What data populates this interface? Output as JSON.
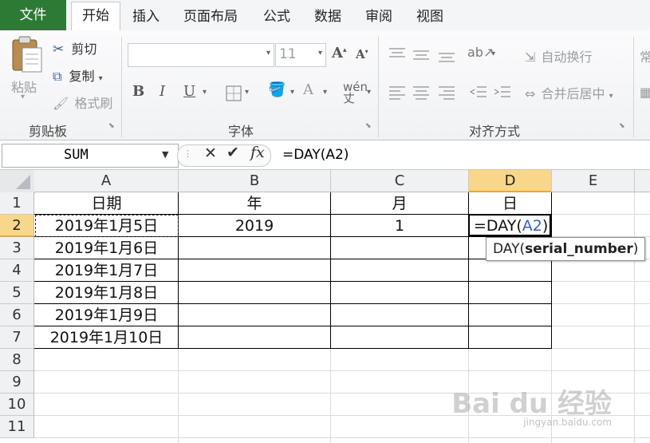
{
  "tabs": {
    "file": "文件",
    "items": [
      "开始",
      "插入",
      "页面布局",
      "公式",
      "数据",
      "审阅",
      "视图"
    ]
  },
  "clipboard": {
    "paste": "粘贴",
    "cut": "剪切",
    "copy": "复制",
    "format_painter": "格式刷",
    "group_label": "剪贴板"
  },
  "font": {
    "size": "11",
    "group_label": "字体"
  },
  "alignment": {
    "wrap_text": "自动换行",
    "merge_center": "合并后居中",
    "group_label": "对齐方式"
  },
  "number": {
    "format_partial": "常"
  },
  "formula_bar": {
    "name_box": "SUM",
    "formula": "=DAY(A2)"
  },
  "grid": {
    "columns": [
      "A",
      "B",
      "C",
      "D",
      "E"
    ],
    "rows": [
      "1",
      "2",
      "3",
      "4",
      "5",
      "6",
      "7",
      "8",
      "9",
      "10",
      "11"
    ],
    "header_row": {
      "A": "日期",
      "B": "年",
      "C": "月",
      "D": "日"
    },
    "data": [
      {
        "A": "2019年1月5日",
        "B": "2019",
        "C": "1"
      },
      {
        "A": "2019年1月6日"
      },
      {
        "A": "2019年1月7日"
      },
      {
        "A": "2019年1月8日"
      },
      {
        "A": "2019年1月9日"
      },
      {
        "A": "2019年1月10日"
      }
    ],
    "editing_cell": {
      "prefix": "=DAY(",
      "ref": "A2",
      "suffix": ")"
    },
    "tooltip": {
      "fn": "DAY(",
      "arg": "serial_number",
      "close": ")"
    }
  },
  "colors": {
    "file_tab": "#2d7a35",
    "header_highlight": "#f9d78a",
    "cell_ref_blue": "#2e5fd6"
  },
  "watermark": {
    "main": "Bai du 经验",
    "sub": "jingyan.baidu.com"
  }
}
